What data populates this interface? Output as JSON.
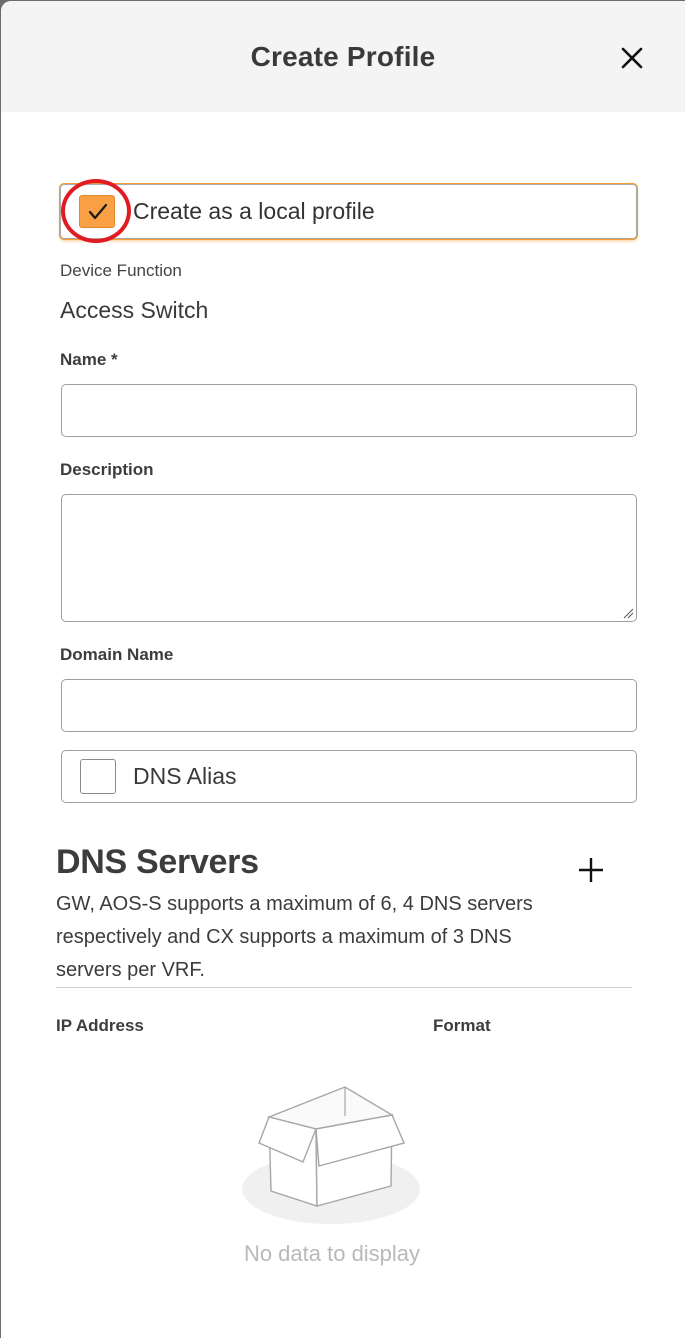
{
  "dialog": {
    "title": "Create Profile",
    "close_icon": "close-icon"
  },
  "local_profile": {
    "label": "Create as a local profile",
    "checked": true,
    "accent_color": "#f8a043",
    "highlight_color": "#e01b24"
  },
  "device_function": {
    "label": "Device Function",
    "value": "Access Switch"
  },
  "form": {
    "name_label": "Name *",
    "name_value": "",
    "description_label": "Description",
    "description_value": "",
    "domain_label": "Domain Name",
    "domain_value": "",
    "dns_alias_label": "DNS Alias",
    "dns_alias_checked": false
  },
  "dns_servers": {
    "title": "DNS Servers",
    "add_icon": "plus-icon",
    "description": "GW, AOS-S supports a maximum of 6, 4 DNS servers respectively and CX supports a maximum of 3 DNS servers per VRF.",
    "columns": [
      "IP Address",
      "Format"
    ],
    "rows": [],
    "empty_icon": "empty-box-icon",
    "empty_text": "No data to display"
  }
}
